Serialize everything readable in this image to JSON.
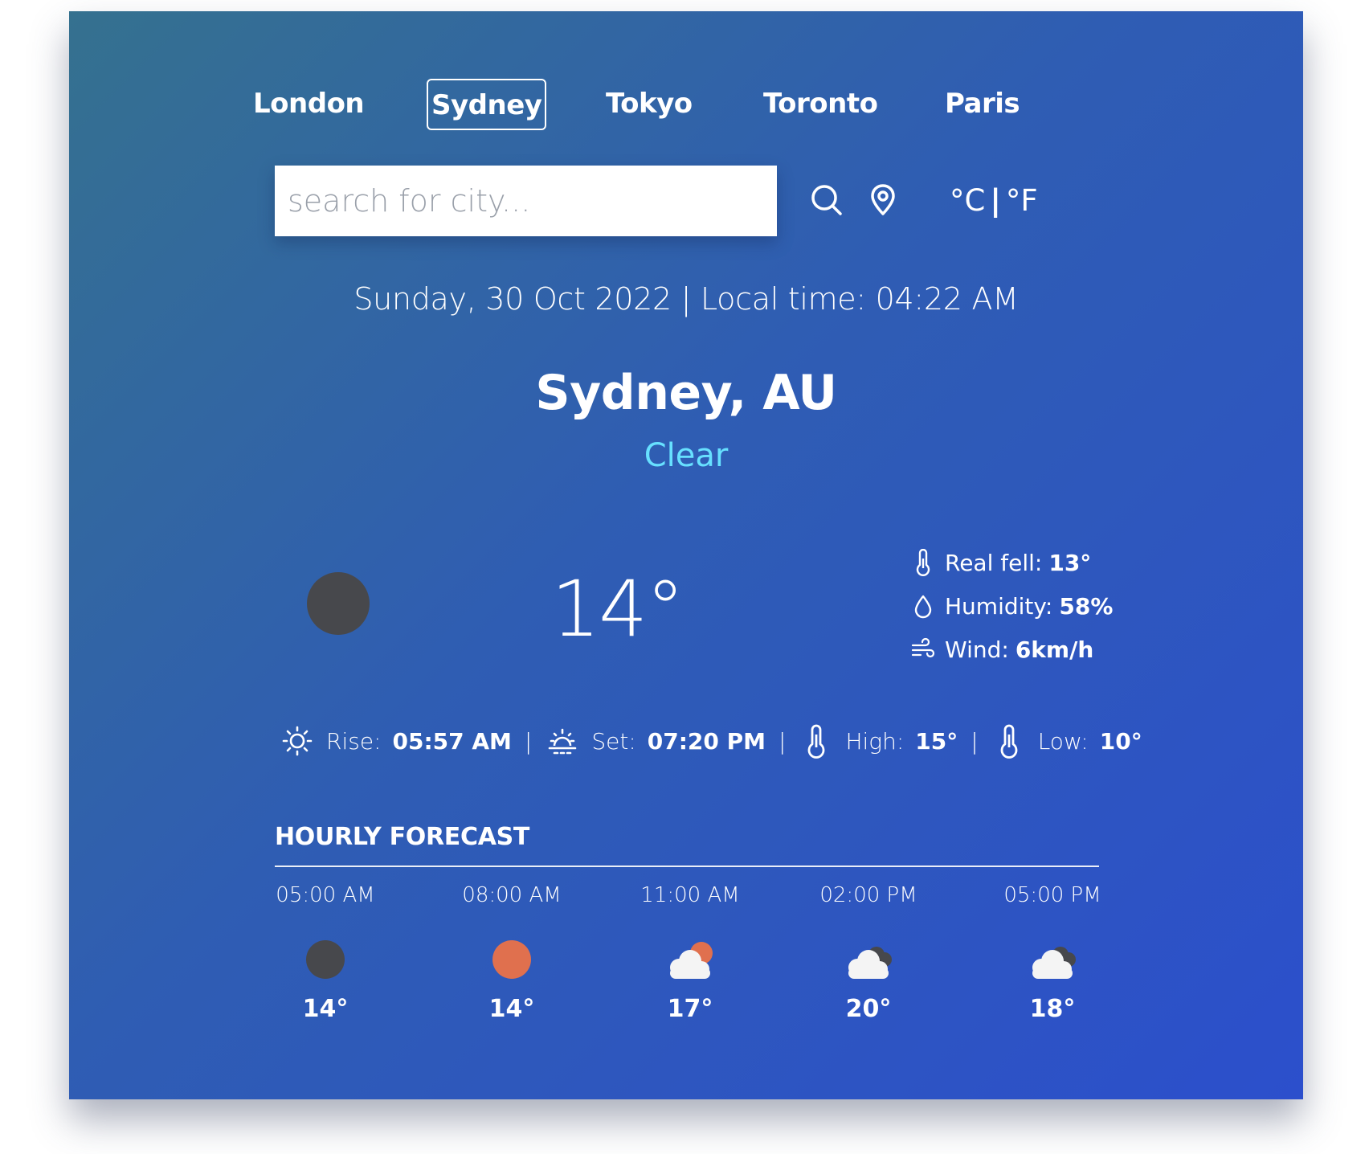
{
  "nav": {
    "cities": [
      "London",
      "Sydney",
      "Tokyo",
      "Toronto",
      "Paris"
    ],
    "selected": "Sydney"
  },
  "search": {
    "placeholder": "search for city..."
  },
  "units": {
    "celsius": "°C",
    "separator": "|",
    "fahrenheit": "°F"
  },
  "datetime": "Sunday, 30 Oct 2022 | Local time: 04:22 AM",
  "location": "Sydney, AU",
  "condition": "Clear",
  "current": {
    "temperature": "14°",
    "icon": "moon-icon",
    "icon_color": "#47484c",
    "details": {
      "feels_label": "Real fell:",
      "feels_value": "13°",
      "humidity_label": "Humidity:",
      "humidity_value": "58%",
      "wind_label": "Wind:",
      "wind_value": "6km/h"
    }
  },
  "sun": {
    "rise_label": "Rise:",
    "rise_value": "05:57 AM",
    "set_label": "Set:",
    "set_value": "07:20 PM",
    "high_label": "High:",
    "high_value": "15°",
    "low_label": "Low:",
    "low_value": "10°",
    "separator": "|"
  },
  "forecast": {
    "title": "HOURLY FORECAST",
    "items": [
      {
        "time": "05:00 AM",
        "icon": "moon-icon",
        "temp": "14°"
      },
      {
        "time": "08:00 AM",
        "icon": "sun-icon",
        "temp": "14°"
      },
      {
        "time": "11:00 AM",
        "icon": "partly-cloudy-icon",
        "temp": "17°"
      },
      {
        "time": "02:00 PM",
        "icon": "broken-clouds-icon",
        "temp": "20°"
      },
      {
        "time": "05:00 PM",
        "icon": "broken-clouds-icon",
        "temp": "18°"
      }
    ]
  },
  "colors": {
    "gradient_start": "#35718f",
    "gradient_end": "#2c4fcc",
    "condition_text": "#67e0ff",
    "sun_orange": "#e0704e",
    "moon_grey": "#47484c"
  }
}
